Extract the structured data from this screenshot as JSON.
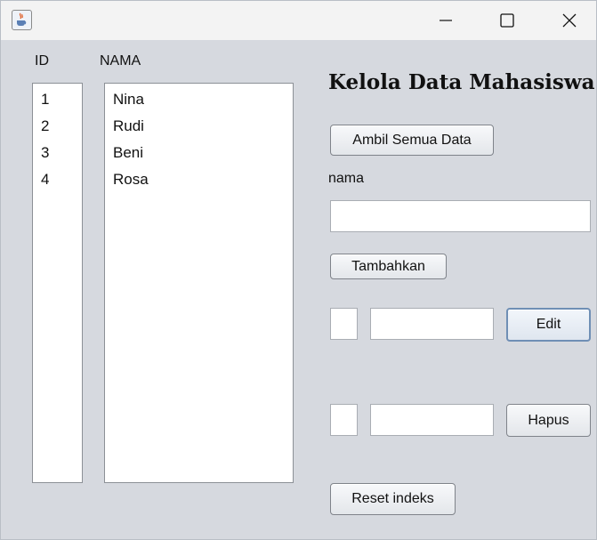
{
  "window": {
    "icon": "java-cup-icon",
    "controls": {
      "minimize": "minimize-icon",
      "maximize": "maximize-icon",
      "close": "close-icon"
    }
  },
  "list_headers": {
    "id": "ID",
    "nama": "NAMA"
  },
  "id_list": [
    "1",
    "2",
    "3",
    "4"
  ],
  "nama_list": [
    "Nina",
    "Rudi",
    "Beni",
    "Rosa"
  ],
  "form": {
    "title": "Kelola Data Mahasiswa",
    "load_all_label": "Ambil Semua Data",
    "nama_label": "nama",
    "nama_value": "",
    "add_label": "Tambahkan",
    "edit": {
      "id_value": "",
      "nama_value": "",
      "label": "Edit"
    },
    "delete": {
      "id_value": "",
      "nama_value": "",
      "label": "Hapus"
    },
    "reset_label": "Reset indeks"
  },
  "colors": {
    "window_bg": "#d6d9df",
    "titlebar_bg": "#f3f3f3",
    "focus_border": "#6f8fb5"
  }
}
